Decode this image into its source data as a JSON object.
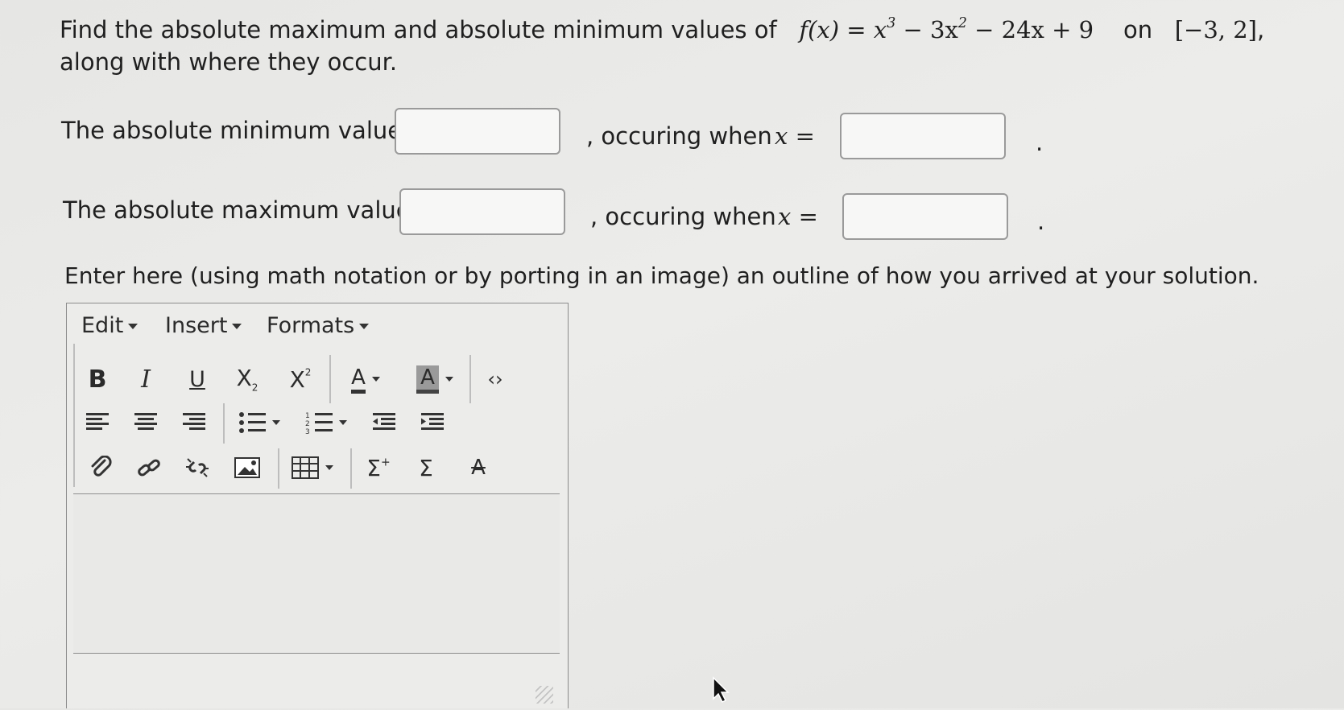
{
  "question": {
    "line1_text": "Find the absolute maximum and absolute minimum values of",
    "fx": "f(x)",
    "eq_rhs_parts": [
      "x",
      "3",
      " − 3x",
      "2",
      " − 24x + 9"
    ],
    "on_word": "on",
    "interval": "[−3, 2]",
    "trailing": ",",
    "line2_text": "along with where they occur."
  },
  "min_row": {
    "label": "The absolute minimum value is",
    "occurring": ", occuring when",
    "x_eq": "x =",
    "value": "",
    "x_value": "",
    "end": "."
  },
  "max_row": {
    "label": "The absolute maximum value is",
    "occurring": ", occuring when",
    "x_eq": "x =",
    "value": "",
    "x_value": "",
    "end": "."
  },
  "instructions": "Enter here (using math notation or by porting in an image) an outline of how you arrived at your solution.",
  "editor": {
    "menus": [
      "Edit",
      "Insert",
      "Formats"
    ],
    "content": ""
  }
}
